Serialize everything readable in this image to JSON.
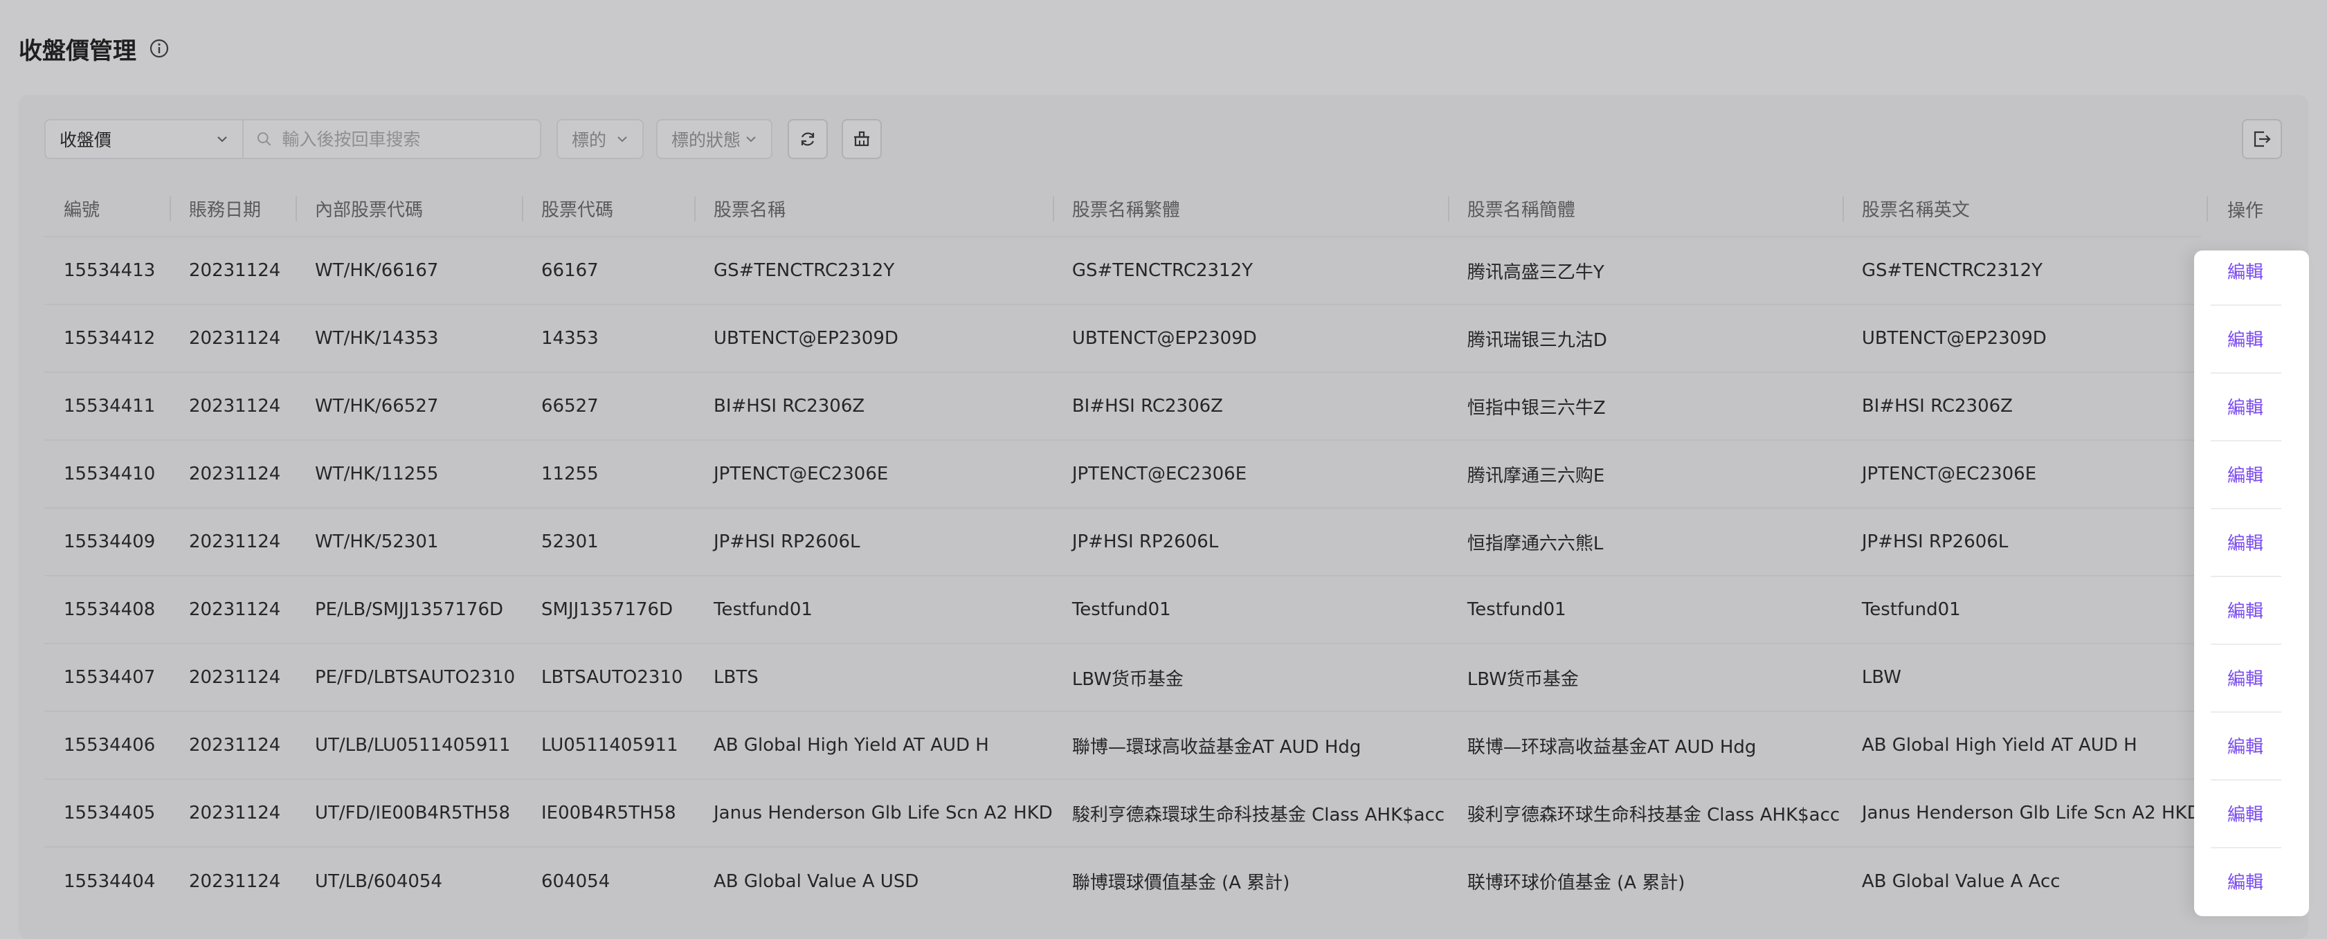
{
  "page": {
    "title": "收盤價管理"
  },
  "toolbar": {
    "price_select": "收盤價",
    "search_placeholder": "輸入後按回車搜索",
    "filter_target": "標的",
    "filter_status": "標的狀態"
  },
  "table": {
    "columns": [
      "編號",
      "賬務日期",
      "內部股票代碼",
      "股票代碼",
      "股票名稱",
      "股票名稱繁體",
      "股票名稱簡體",
      "股票名稱英文"
    ],
    "action_header": "操作",
    "action_label": "編輯",
    "rows": [
      [
        "15534413",
        "20231124",
        "WT/HK/66167",
        "66167",
        "GS#TENCTRC2312Y",
        "GS#TENCTRC2312Y",
        "腾讯高盛三乙牛Y",
        "GS#TENCTRC2312Y"
      ],
      [
        "15534412",
        "20231124",
        "WT/HK/14353",
        "14353",
        "UBTENCT@EP2309D",
        "UBTENCT@EP2309D",
        "腾讯瑞银三九沽D",
        "UBTENCT@EP2309D"
      ],
      [
        "15534411",
        "20231124",
        "WT/HK/66527",
        "66527",
        "BI#HSI RC2306Z",
        "BI#HSI RC2306Z",
        "恒指中银三六牛Z",
        "BI#HSI RC2306Z"
      ],
      [
        "15534410",
        "20231124",
        "WT/HK/11255",
        "11255",
        "JPTENCT@EC2306E",
        "JPTENCT@EC2306E",
        "腾讯摩通三六购E",
        "JPTENCT@EC2306E"
      ],
      [
        "15534409",
        "20231124",
        "WT/HK/52301",
        "52301",
        "JP#HSI RP2606L",
        "JP#HSI RP2606L",
        "恒指摩通六六熊L",
        "JP#HSI RP2606L"
      ],
      [
        "15534408",
        "20231124",
        "PE/LB/SMJJ1357176D",
        "SMJJ1357176D",
        "Testfund01",
        "Testfund01",
        "Testfund01",
        "Testfund01"
      ],
      [
        "15534407",
        "20231124",
        "PE/FD/LBTSAUTO2310",
        "LBTSAUTO2310",
        "LBTS",
        "LBW货币基金",
        "LBW货币基金",
        "LBW"
      ],
      [
        "15534406",
        "20231124",
        "UT/LB/LU0511405911",
        "LU0511405911",
        "AB Global High Yield AT AUD H",
        "聯博—環球高收益基金AT AUD Hdg",
        "联博—环球高收益基金AT AUD Hdg",
        "AB Global High Yield AT AUD H"
      ],
      [
        "15534405",
        "20231124",
        "UT/FD/IE00B4R5TH58",
        "IE00B4R5TH58",
        "Janus Henderson Glb Life Scn A2 HKD",
        "駿利亨德森環球生命科技基金 Class AHK$acc",
        "骏利亨德森环球生命科技基金 Class AHK$acc",
        "Janus Henderson Glb Life Scn A2 HKD"
      ],
      [
        "15534404",
        "20231124",
        "UT/LB/604054",
        "604054",
        "AB Global Value A USD",
        "聯博環球價值基金 (A 累計)",
        "联博环球价值基金 (A 累計)",
        "AB Global Value A Acc"
      ]
    ]
  }
}
